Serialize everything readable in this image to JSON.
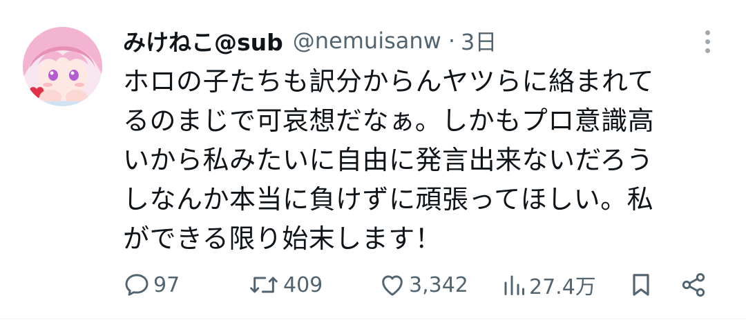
{
  "tweet": {
    "display_name": "みけねこ@sub",
    "handle": "@nemuisanw",
    "separator": "·",
    "time": "3日",
    "text_lines": [
      "ホロの子たちも訳分からんヤツらに絡まれて",
      "るのまじで可哀想だなぁ。しかもプロ意識高",
      "いから私みたいに自由に発言出来ないだろう",
      "しなんか本当に負けずに頑張ってほしい。私",
      "ができる限り始末します！"
    ]
  },
  "actions": {
    "reply_count": "97",
    "retweet_count": "409",
    "like_count": "3,342",
    "views_count": "27.4万"
  },
  "icons": {
    "reply": "reply-icon",
    "retweet": "retweet-icon",
    "like": "heart-icon",
    "views": "views-icon",
    "bookmark": "bookmark-icon",
    "share": "share-icon",
    "more": "more-vertical-icon"
  },
  "colors": {
    "text": "#0f1419",
    "muted": "#536471",
    "avatar_hair": "#f2b4d0"
  }
}
